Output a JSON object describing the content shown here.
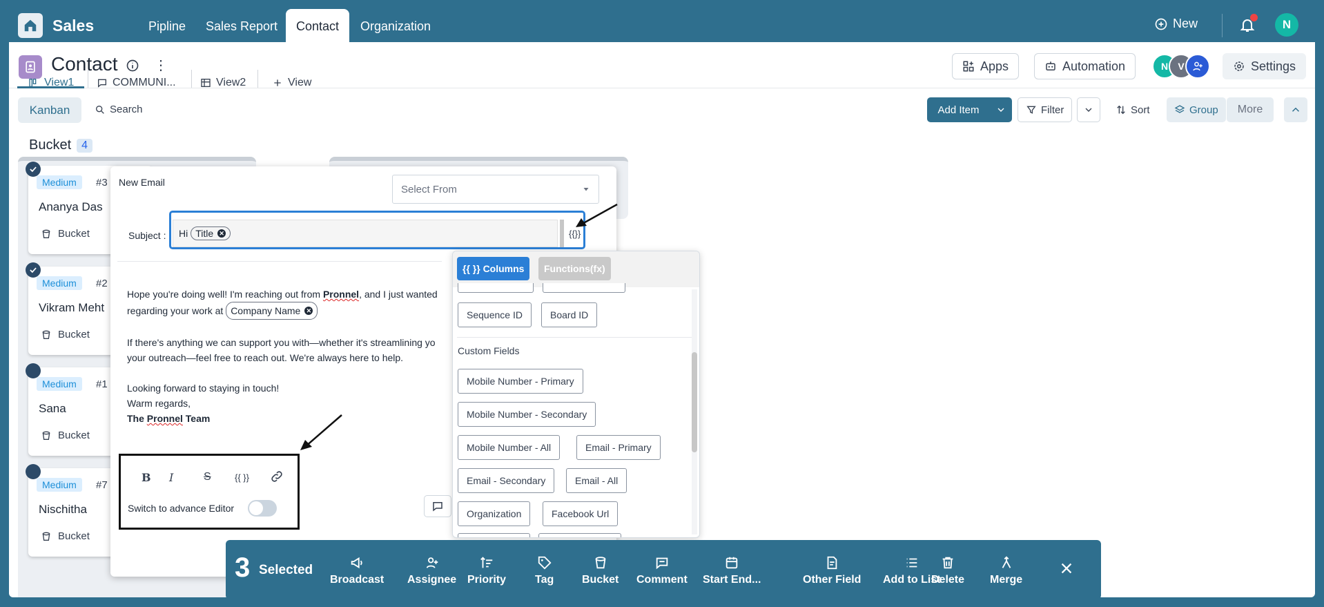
{
  "topbar": {
    "app_name": "Sales",
    "tabs": [
      "Pipline",
      "Sales Report",
      "Contact",
      "Organization"
    ],
    "active_tab": "Contact",
    "new_label": "New",
    "user_initial": "N"
  },
  "header": {
    "title": "Contact",
    "apps_label": "Apps",
    "automation_label": "Automation",
    "settings_label": "Settings",
    "member_avatars": [
      "N",
      "V",
      ""
    ]
  },
  "views": {
    "tabs": [
      {
        "label": "View1",
        "icon": "kanban-icon",
        "active": true
      },
      {
        "label": "COMMUNI...",
        "icon": "comment-icon",
        "active": false
      },
      {
        "label": "View2",
        "icon": "table-icon",
        "active": false
      }
    ],
    "add_view_label": "View"
  },
  "toolbar": {
    "kanban_label": "Kanban",
    "search_label": "Search",
    "add_item_label": "Add Item",
    "filter_label": "Filter",
    "sort_label": "Sort",
    "group_label": "Group",
    "more_label": "More"
  },
  "board": {
    "bucket_name": "Bucket",
    "bucket_count": "4",
    "cards": [
      {
        "priority": "Medium",
        "number": "#3",
        "name": "Ananya Das",
        "bucket": "Bucket",
        "checked": true
      },
      {
        "priority": "Medium",
        "number": "#2",
        "name": "Vikram Meht",
        "bucket": "Bucket",
        "checked": true
      },
      {
        "priority": "Medium",
        "number": "#1",
        "name": "Sana",
        "bucket": "Bucket",
        "checked": false
      },
      {
        "priority": "Medium",
        "number": "#7",
        "name": "Nischitha",
        "bucket": "Bucket",
        "checked": false
      }
    ]
  },
  "email": {
    "title": "New Email",
    "select_placeholder": "Select From",
    "subject_label": "Subject :",
    "subject_text": "Hi",
    "subject_chip": "Title",
    "variable_button": "{{}}",
    "body_p1_a": "Hope you're doing well! I'm reaching out from ",
    "body_p1_brand": "Pronnel",
    "body_p1_b": ", and I just wanted",
    "body_p1_c": "regarding your work at ",
    "body_chip": "Company Name",
    "body_p2_a": "If there's anything we can support you with—whether it's streamlining yo",
    "body_p2_b": "your outreach—feel free to reach out. We're always here to help.",
    "body_p3_a": "Looking forward to staying in touch!",
    "body_p3_b": "Warm regards,",
    "signature_a": "The ",
    "signature_brand": "Pronnel",
    "signature_b": " Team",
    "format_bold": "B",
    "format_italic": "I",
    "format_strike": "S",
    "format_variable": "{{ }}",
    "switch_label": "Switch to advance Editor",
    "advance_editor_on": false
  },
  "variable_panel": {
    "tab_columns": "{{ }} Columns",
    "tab_functions": "Functions(fx)",
    "system_fields": [
      "Sequence ID",
      "Board ID"
    ],
    "section_title": "Custom Fields",
    "custom_fields": [
      "Mobile Number - Primary",
      "Mobile Number - Secondary",
      "Mobile Number - All",
      "Email - Primary",
      "Email - Secondary",
      "Email - All",
      "Organization",
      "Facebook Url"
    ]
  },
  "selection_bar": {
    "count": "3",
    "label": "Selected",
    "actions": [
      "Broadcast",
      "Assignee",
      "Priority",
      "Tag",
      "Bucket",
      "Comment",
      "Start End...",
      "Other Field",
      "Add to List",
      "Delete",
      "Merge"
    ]
  },
  "colors": {
    "brand": "#2f6f8e",
    "accent_blue": "#2b7fd6",
    "priority_tag": "#1d8fd8"
  }
}
